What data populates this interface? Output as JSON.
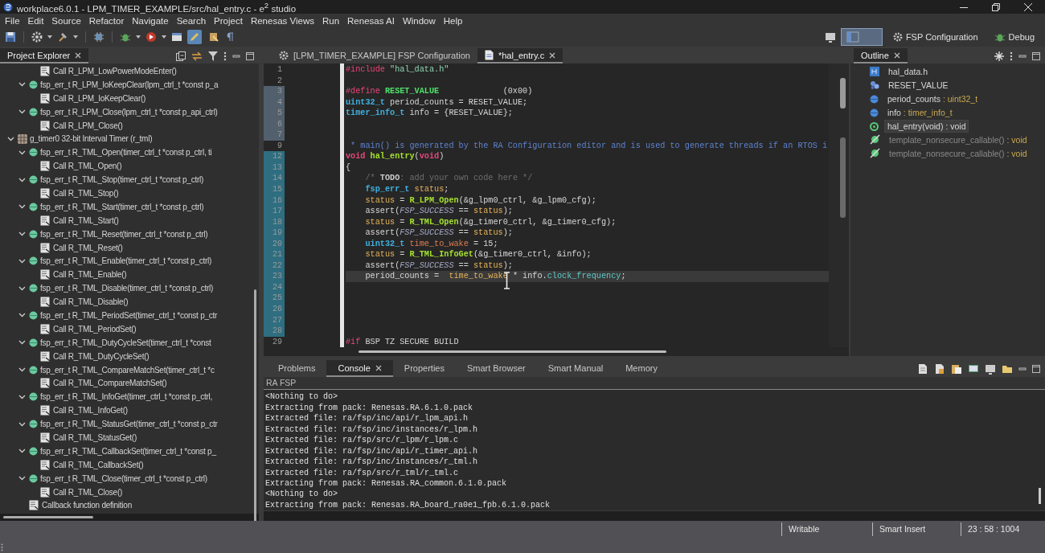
{
  "window": {
    "title": "workplace6.0.1 - LPM_TIMER_EXAMPLE/src/hal_entry.c - e$^{2}$ studio"
  },
  "menu": [
    "File",
    "Edit",
    "Source",
    "Refactor",
    "Navigate",
    "Search",
    "Project",
    "Renesas Views",
    "Run",
    "Renesas AI",
    "Window",
    "Help"
  ],
  "toolbar_toggles": [
    {
      "on": true
    },
    {
      "on": false
    }
  ],
  "perspectives": [
    {
      "kind": "icon",
      "selected": true
    },
    {
      "kind": "labeled",
      "label": "FSP Configuration",
      "selected": false
    },
    {
      "kind": "labeled",
      "label": "Debug",
      "selected": false
    }
  ],
  "project_explorer": {
    "title": "Project Explorer",
    "closable": true,
    "tree": [
      {
        "kind": "continued",
        "children": [
          {
            "kind": "continued",
            "children": [
              {
                "kind": "call",
                "label": "Call R_LPM_LowPowerModeEnter()"
              }
            ]
          },
          {
            "kind": "function",
            "label": "fsp_err_t R_LPM_IoKeepClear(lpm_ctrl_t *const p_a",
            "expanded": true,
            "children": [
              {
                "kind": "call",
                "label": "Call R_LPM_IoKeepClear()"
              }
            ]
          },
          {
            "kind": "function",
            "label": "fsp_err_t R_LPM_Close(lpm_ctrl_t *const p_api_ctrl)",
            "expanded": true,
            "children": [
              {
                "kind": "call",
                "label": "Call R_LPM_Close()"
              }
            ]
          }
        ]
      },
      {
        "kind": "component",
        "label": "g_timer0 32-bit Interval Timer (r_tml)",
        "expanded": true,
        "children": [
          {
            "kind": "function",
            "label": "fsp_err_t R_TML_Open(timer_ctrl_t *const p_ctrl, ti",
            "expanded": true,
            "children": [
              {
                "kind": "call",
                "label": "Call R_TML_Open()"
              }
            ]
          },
          {
            "kind": "function",
            "label": "fsp_err_t R_TML_Stop(timer_ctrl_t *const p_ctrl)",
            "expanded": true,
            "children": [
              {
                "kind": "call",
                "label": "Call R_TML_Stop()"
              }
            ]
          },
          {
            "kind": "function",
            "label": "fsp_err_t R_TML_Start(timer_ctrl_t *const p_ctrl)",
            "expanded": true,
            "children": [
              {
                "kind": "call",
                "label": "Call R_TML_Start()"
              }
            ]
          },
          {
            "kind": "function",
            "label": "fsp_err_t R_TML_Reset(timer_ctrl_t *const p_ctrl)",
            "expanded": true,
            "children": [
              {
                "kind": "call",
                "label": "Call R_TML_Reset()"
              }
            ]
          },
          {
            "kind": "function",
            "label": "fsp_err_t R_TML_Enable(timer_ctrl_t *const p_ctrl)",
            "expanded": true,
            "children": [
              {
                "kind": "call",
                "label": "Call R_TML_Enable()"
              }
            ]
          },
          {
            "kind": "function",
            "label": "fsp_err_t R_TML_Disable(timer_ctrl_t *const p_ctrl)",
            "expanded": true,
            "children": [
              {
                "kind": "call",
                "label": "Call R_TML_Disable()"
              }
            ]
          },
          {
            "kind": "function",
            "label": "fsp_err_t R_TML_PeriodSet(timer_ctrl_t *const p_ctr",
            "expanded": true,
            "children": [
              {
                "kind": "call",
                "label": "Call R_TML_PeriodSet()"
              }
            ]
          },
          {
            "kind": "function",
            "label": "fsp_err_t R_TML_DutyCycleSet(timer_ctrl_t *const",
            "expanded": true,
            "children": [
              {
                "kind": "call",
                "label": "Call R_TML_DutyCycleSet()"
              }
            ]
          },
          {
            "kind": "function",
            "label": "fsp_err_t R_TML_CompareMatchSet(timer_ctrl_t *c",
            "expanded": true,
            "children": [
              {
                "kind": "call",
                "label": "Call R_TML_CompareMatchSet()"
              }
            ]
          },
          {
            "kind": "function",
            "label": "fsp_err_t R_TML_InfoGet(timer_ctrl_t *const p_ctrl,",
            "expanded": true,
            "children": [
              {
                "kind": "call",
                "label": "Call R_TML_InfoGet()"
              }
            ]
          },
          {
            "kind": "function",
            "label": "fsp_err_t R_TML_StatusGet(timer_ctrl_t *const p_ctr",
            "expanded": true,
            "children": [
              {
                "kind": "call",
                "label": "Call R_TML_StatusGet()"
              }
            ]
          },
          {
            "kind": "function",
            "label": "fsp_err_t R_TML_CallbackSet(timer_ctrl_t *const p_",
            "expanded": true,
            "children": [
              {
                "kind": "call",
                "label": "Call R_TML_CallbackSet()"
              }
            ]
          },
          {
            "kind": "function",
            "label": "fsp_err_t R_TML_Close(timer_ctrl_t *const p_ctrl)",
            "expanded": true,
            "children": [
              {
                "kind": "call",
                "label": "Call R_TML_Close()"
              }
            ]
          },
          {
            "kind": "callback",
            "label": "Callback function definition"
          }
        ]
      }
    ]
  },
  "editor": {
    "tabs": [
      {
        "label": "[LPM_TIMER_EXAMPLE] FSP Configuration",
        "kind": "config",
        "selected": false,
        "closable": false
      },
      {
        "label": "*hal_entry.c",
        "kind": "source",
        "selected": true,
        "closable": true
      }
    ],
    "lines": [
      {
        "number": "1",
        "modified": false,
        "added": false,
        "current": false,
        "tokens": [
          {
            "kind": "preproc",
            "text": "#include"
          },
          {
            "kind": "string",
            "text": " \"hal_data.h\""
          }
        ]
      },
      {
        "number": "2",
        "modified": false,
        "added": false,
        "current": false
      },
      {
        "number": "3",
        "modified": true,
        "added": false,
        "current": false,
        "tokens": [
          {
            "kind": "preproc",
            "text": "#define"
          },
          {
            "kind": "macro",
            "text": " RESET_VALUE"
          },
          {
            "kind": "plain",
            "text": "             (0x00)"
          }
        ]
      },
      {
        "number": "4",
        "modified": true,
        "added": false,
        "current": false,
        "tokens": [
          {
            "kind": "type",
            "text": "uint32_t"
          },
          {
            "kind": "plain",
            "text": " period_counts = RESET_VALUE;"
          }
        ]
      },
      {
        "number": "5",
        "modified": true,
        "added": false,
        "current": false,
        "tokens": [
          {
            "kind": "type",
            "text": "timer_info_t"
          },
          {
            "kind": "plain",
            "text": " info = {RESET_VALUE};"
          }
        ]
      },
      {
        "number": "6",
        "modified": true,
        "added": false,
        "current": false
      },
      {
        "number": "7",
        "modified": true,
        "added": false,
        "current": false
      },
      {
        "number": "9",
        "modified": false,
        "added": false,
        "current": false,
        "tokens": [
          {
            "kind": "doc",
            "text": " * main() is generated by the RA Configuration editor and is used to generate threads if an RTOS i"
          }
        ]
      },
      {
        "number": "12",
        "modified": false,
        "added": true,
        "current": false,
        "tokens": [
          {
            "kind": "keyword",
            "text": "void"
          },
          {
            "kind": "func",
            "text": " hal_entry"
          },
          {
            "kind": "plain",
            "text": "("
          },
          {
            "kind": "keyword",
            "text": "void"
          },
          {
            "kind": "plain",
            "text": ")"
          }
        ]
      },
      {
        "number": "13",
        "modified": false,
        "added": true,
        "current": false,
        "tokens": [
          {
            "kind": "plain",
            "text": "{"
          }
        ]
      },
      {
        "number": "14",
        "modified": false,
        "added": true,
        "current": false,
        "tokens": [
          {
            "kind": "comment",
            "text": "    /* "
          },
          {
            "kind": "task",
            "text": "TODO"
          },
          {
            "kind": "comment",
            "text": ": add your own code here */"
          }
        ]
      },
      {
        "number": "15",
        "modified": false,
        "added": true,
        "current": false,
        "tokens": [
          {
            "kind": "type",
            "text": "    fsp_err_t"
          },
          {
            "kind": "var",
            "text": " status"
          },
          {
            "kind": "plain",
            "text": ";"
          }
        ]
      },
      {
        "number": "16",
        "modified": false,
        "added": true,
        "current": false,
        "tokens": [
          {
            "kind": "var",
            "text": "    status"
          },
          {
            "kind": "plain",
            "text": " = "
          },
          {
            "kind": "func",
            "text": "R_LPM_Open"
          },
          {
            "kind": "plain",
            "text": "(&g_lpm0_ctrl, &g_lpm0_cfg);"
          }
        ]
      },
      {
        "number": "17",
        "modified": false,
        "added": true,
        "current": false,
        "tokens": [
          {
            "kind": "plain",
            "text": "    assert("
          },
          {
            "kind": "const",
            "text": "FSP_SUCCESS"
          },
          {
            "kind": "plain",
            "text": " == "
          },
          {
            "kind": "var",
            "text": "status"
          },
          {
            "kind": "plain",
            "text": ");"
          }
        ]
      },
      {
        "number": "18",
        "modified": false,
        "added": true,
        "current": false,
        "tokens": [
          {
            "kind": "var",
            "text": "    status"
          },
          {
            "kind": "plain",
            "text": " = "
          },
          {
            "kind": "func",
            "text": "R_TML_Open"
          },
          {
            "kind": "plain",
            "text": "(&g_timer0_ctrl, &g_timer0_cfg);"
          }
        ]
      },
      {
        "number": "19",
        "modified": false,
        "added": true,
        "current": false,
        "tokens": [
          {
            "kind": "plain",
            "text": "    assert("
          },
          {
            "kind": "const",
            "text": "FSP_SUCCESS"
          },
          {
            "kind": "plain",
            "text": " == "
          },
          {
            "kind": "var",
            "text": "status"
          },
          {
            "kind": "plain",
            "text": ");"
          }
        ]
      },
      {
        "number": "20",
        "modified": false,
        "added": true,
        "current": false,
        "tokens": [
          {
            "kind": "type",
            "text": "    uint32_t"
          },
          {
            "kind": "local",
            "text": " time_to_wake"
          },
          {
            "kind": "plain",
            "text": " = 15;"
          }
        ]
      },
      {
        "number": "21",
        "modified": false,
        "added": true,
        "current": false,
        "tokens": [
          {
            "kind": "var",
            "text": "    status"
          },
          {
            "kind": "plain",
            "text": " = "
          },
          {
            "kind": "func",
            "text": "R_TML_InfoGet"
          },
          {
            "kind": "plain",
            "text": "(&g_timer0_ctrl, &info);"
          }
        ]
      },
      {
        "number": "22",
        "modified": false,
        "added": true,
        "current": false,
        "tokens": [
          {
            "kind": "plain",
            "text": "    assert("
          },
          {
            "kind": "const",
            "text": "FSP_SUCCESS"
          },
          {
            "kind": "plain",
            "text": " == "
          },
          {
            "kind": "var",
            "text": "status"
          },
          {
            "kind": "plain",
            "text": ");"
          }
        ]
      },
      {
        "number": "23",
        "modified": false,
        "added": true,
        "current": true,
        "tokens": [
          {
            "kind": "plain",
            "text": "    period_counts =  "
          },
          {
            "kind": "var",
            "text": "time_to_wake"
          },
          {
            "kind": "plain",
            "text": " * info."
          },
          {
            "kind": "field",
            "text": "clock_frequency"
          },
          {
            "kind": "plain",
            "text": ";"
          }
        ]
      },
      {
        "number": "24",
        "modified": false,
        "added": true,
        "current": false
      },
      {
        "number": "25",
        "modified": false,
        "added": true,
        "current": false
      },
      {
        "number": "26",
        "modified": false,
        "added": true,
        "current": false
      },
      {
        "number": "27",
        "modified": false,
        "added": true,
        "current": false
      },
      {
        "number": "28",
        "modified": false,
        "added": true,
        "current": false
      },
      {
        "number": "29",
        "modified": false,
        "added": false,
        "current": false,
        "tokens": [
          {
            "kind": "preproc",
            "text": "#if"
          },
          {
            "kind": "plain",
            "text": " BSP TZ SECURE BUILD"
          }
        ]
      }
    ]
  },
  "outline": {
    "title": "Outline",
    "closable": true,
    "items": [
      {
        "kind": "include",
        "label": "hal_data.h",
        "selected": false,
        "inactive": false
      },
      {
        "kind": "macro",
        "label": "RESET_VALUE",
        "selected": false,
        "inactive": false
      },
      {
        "kind": "variable",
        "label": "period_counts",
        "type": ": uint32_t",
        "selected": false,
        "inactive": false
      },
      {
        "kind": "variable",
        "label": "info",
        "type": ": timer_info_t",
        "selected": false,
        "inactive": false
      },
      {
        "kind": "function",
        "label": "hal_entry(void)",
        "type": ": void",
        "selected": true,
        "inactive": false
      },
      {
        "kind": "excluded",
        "label": "template_nonsecure_callable()",
        "type": ": void",
        "selected": false,
        "inactive": true
      },
      {
        "kind": "excluded",
        "label": "template_nonsecure_callable()",
        "type": ": void",
        "selected": false,
        "inactive": true
      }
    ]
  },
  "console": {
    "tabs": [
      {
        "label": "Problems",
        "selected": false,
        "closable": false
      },
      {
        "label": "Console",
        "selected": true,
        "closable": true
      },
      {
        "label": "Properties",
        "selected": false,
        "closable": false
      },
      {
        "label": "Smart Browser",
        "selected": false,
        "closable": false
      },
      {
        "label": "Smart Manual",
        "selected": false,
        "closable": false
      },
      {
        "label": "Memory",
        "selected": false,
        "closable": false
      }
    ],
    "name": "RA FSP",
    "lines": [
      "<Nothing to do>",
      "Extracting from pack: Renesas.RA.6.1.0.pack",
      "Extracted file: ra/fsp/inc/api/r_lpm_api.h",
      "Extracted file: ra/fsp/inc/instances/r_lpm.h",
      "Extracted file: ra/fsp/src/r_lpm/r_lpm.c",
      "Extracted file: ra/fsp/inc/api/r_timer_api.h",
      "Extracted file: ra/fsp/inc/instances/r_tml.h",
      "Extracted file: ra/fsp/src/r_tml/r_tml.c",
      "Extracting from pack: Renesas.RA_common.6.1.0.pack",
      "<Nothing to do>",
      "Extracting from pack: Renesas.RA_board_ra0e1_fpb.6.1.0.pack"
    ]
  },
  "status_bar": [
    "Writable",
    "Smart Insert",
    "23 : 58 : 1004"
  ]
}
